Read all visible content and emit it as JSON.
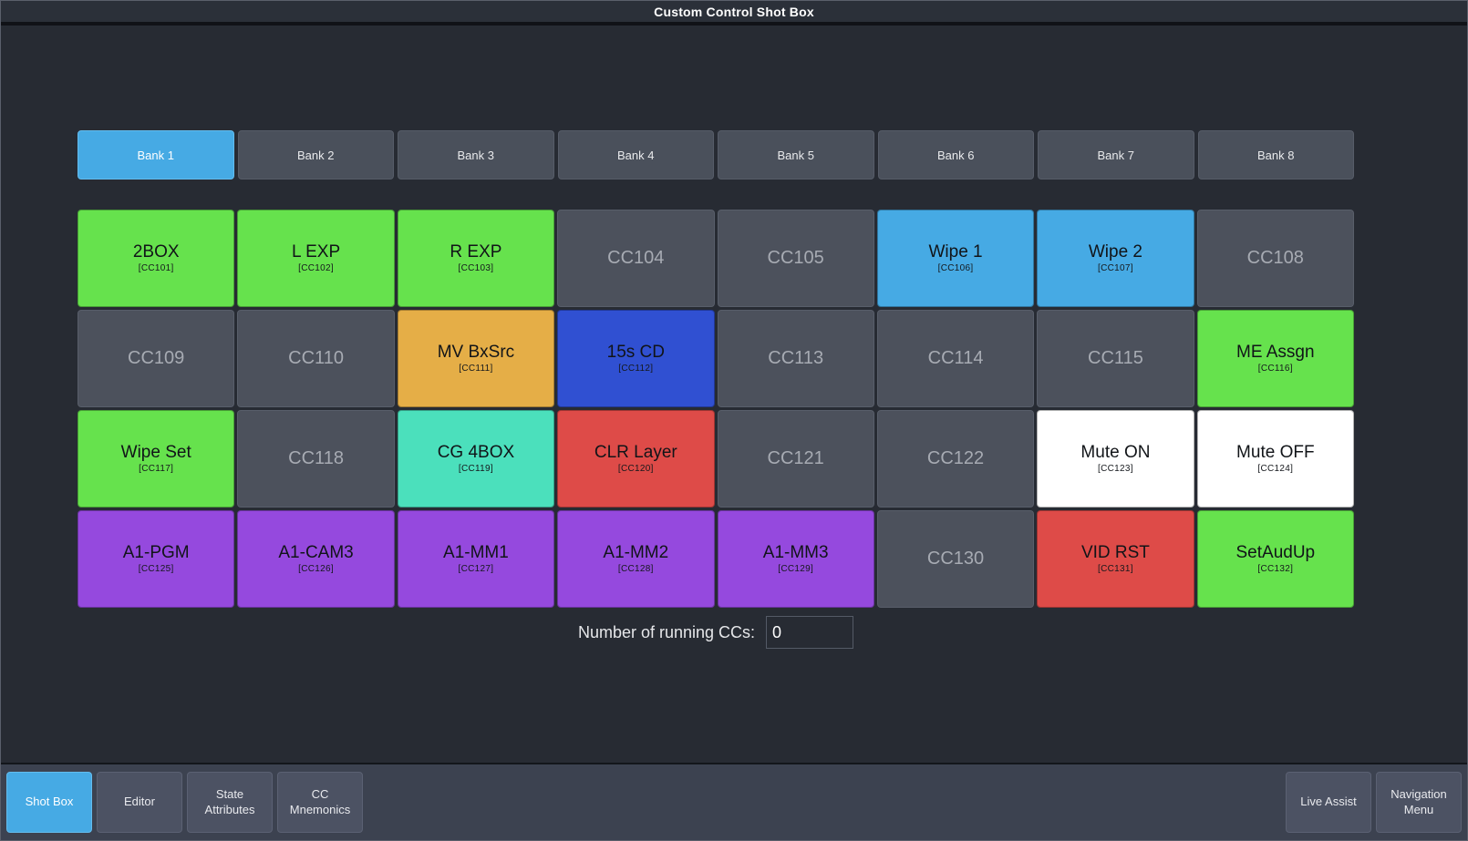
{
  "window": {
    "title": "Custom Control Shot Box"
  },
  "colors": {
    "background": "#272b33",
    "accent_blue": "#46aae4",
    "empty_button": "#4c515c",
    "green": "#66e24d",
    "cyan": "#46aae4",
    "orange": "#e5ae47",
    "royal_blue": "#3050d2",
    "teal": "#4be0bc",
    "red": "#de4b48",
    "white": "#ffffff",
    "purple": "#9549de"
  },
  "banks": {
    "selected_index": 0,
    "items": [
      {
        "label": "Bank 1"
      },
      {
        "label": "Bank 2"
      },
      {
        "label": "Bank 3"
      },
      {
        "label": "Bank 4"
      },
      {
        "label": "Bank 5"
      },
      {
        "label": "Bank 6"
      },
      {
        "label": "Bank 7"
      },
      {
        "label": "Bank 8"
      }
    ]
  },
  "grid": {
    "columns": 8,
    "rows": 4,
    "buttons": [
      {
        "label": "2BOX",
        "cc": "[CC101]",
        "id": "CC101",
        "color": "#66e24d",
        "empty": false
      },
      {
        "label": "L EXP",
        "cc": "[CC102]",
        "id": "CC102",
        "color": "#66e24d",
        "empty": false
      },
      {
        "label": "R EXP",
        "cc": "[CC103]",
        "id": "CC103",
        "color": "#66e24d",
        "empty": false
      },
      {
        "label": "CC104",
        "cc": "",
        "id": "CC104",
        "color": "#4c515c",
        "empty": true
      },
      {
        "label": "CC105",
        "cc": "",
        "id": "CC105",
        "color": "#4c515c",
        "empty": true
      },
      {
        "label": "Wipe 1",
        "cc": "[CC106]",
        "id": "CC106",
        "color": "#46aae4",
        "empty": false
      },
      {
        "label": "Wipe 2",
        "cc": "[CC107]",
        "id": "CC107",
        "color": "#46aae4",
        "empty": false
      },
      {
        "label": "CC108",
        "cc": "",
        "id": "CC108",
        "color": "#4c515c",
        "empty": true
      },
      {
        "label": "CC109",
        "cc": "",
        "id": "CC109",
        "color": "#4c515c",
        "empty": true
      },
      {
        "label": "CC110",
        "cc": "",
        "id": "CC110",
        "color": "#4c515c",
        "empty": true
      },
      {
        "label": "MV BxSrc",
        "cc": "[CC111]",
        "id": "CC111",
        "color": "#e5ae47",
        "empty": false
      },
      {
        "label": "15s CD",
        "cc": "[CC112]",
        "id": "CC112",
        "color": "#3050d2",
        "empty": false
      },
      {
        "label": "CC113",
        "cc": "",
        "id": "CC113",
        "color": "#4c515c",
        "empty": true
      },
      {
        "label": "CC114",
        "cc": "",
        "id": "CC114",
        "color": "#4c515c",
        "empty": true
      },
      {
        "label": "CC115",
        "cc": "",
        "id": "CC115",
        "color": "#4c515c",
        "empty": true
      },
      {
        "label": "ME Assgn",
        "cc": "[CC116]",
        "id": "CC116",
        "color": "#66e24d",
        "empty": false
      },
      {
        "label": "Wipe Set",
        "cc": "[CC117]",
        "id": "CC117",
        "color": "#66e24d",
        "empty": false
      },
      {
        "label": "CC118",
        "cc": "",
        "id": "CC118",
        "color": "#4c515c",
        "empty": true
      },
      {
        "label": "CG 4BOX",
        "cc": "[CC119]",
        "id": "CC119",
        "color": "#4be0bc",
        "empty": false
      },
      {
        "label": "CLR Layer",
        "cc": "[CC120]",
        "id": "CC120",
        "color": "#de4b48",
        "empty": false
      },
      {
        "label": "CC121",
        "cc": "",
        "id": "CC121",
        "color": "#4c515c",
        "empty": true
      },
      {
        "label": "CC122",
        "cc": "",
        "id": "CC122",
        "color": "#4c515c",
        "empty": true
      },
      {
        "label": "Mute ON",
        "cc": "[CC123]",
        "id": "CC123",
        "color": "#ffffff",
        "empty": false
      },
      {
        "label": "Mute OFF",
        "cc": "[CC124]",
        "id": "CC124",
        "color": "#ffffff",
        "empty": false
      },
      {
        "label": "A1-PGM",
        "cc": "[CC125]",
        "id": "CC125",
        "color": "#9549de",
        "empty": false
      },
      {
        "label": "A1-CAM3",
        "cc": "[CC126]",
        "id": "CC126",
        "color": "#9549de",
        "empty": false
      },
      {
        "label": "A1-MM1",
        "cc": "[CC127]",
        "id": "CC127",
        "color": "#9549de",
        "empty": false
      },
      {
        "label": "A1-MM2",
        "cc": "[CC128]",
        "id": "CC128",
        "color": "#9549de",
        "empty": false
      },
      {
        "label": "A1-MM3",
        "cc": "[CC129]",
        "id": "CC129",
        "color": "#9549de",
        "empty": false
      },
      {
        "label": "CC130",
        "cc": "",
        "id": "CC130",
        "color": "#4c515c",
        "empty": true
      },
      {
        "label": "VID RST",
        "cc": "[CC131]",
        "id": "CC131",
        "color": "#de4b48",
        "empty": false
      },
      {
        "label": "SetAudUp",
        "cc": "[CC132]",
        "id": "CC132",
        "color": "#66e24d",
        "empty": false
      }
    ]
  },
  "running": {
    "label": "Number of running CCs:",
    "value": "0"
  },
  "toolbar": {
    "left": [
      {
        "label": "Shot Box",
        "selected": true
      },
      {
        "label": "Editor",
        "selected": false
      },
      {
        "label": "State\nAttributes",
        "selected": false
      },
      {
        "label": "CC\nMnemonics",
        "selected": false
      }
    ],
    "right": [
      {
        "label": "Live Assist",
        "selected": false
      },
      {
        "label": "Navigation\nMenu",
        "selected": false
      }
    ]
  }
}
